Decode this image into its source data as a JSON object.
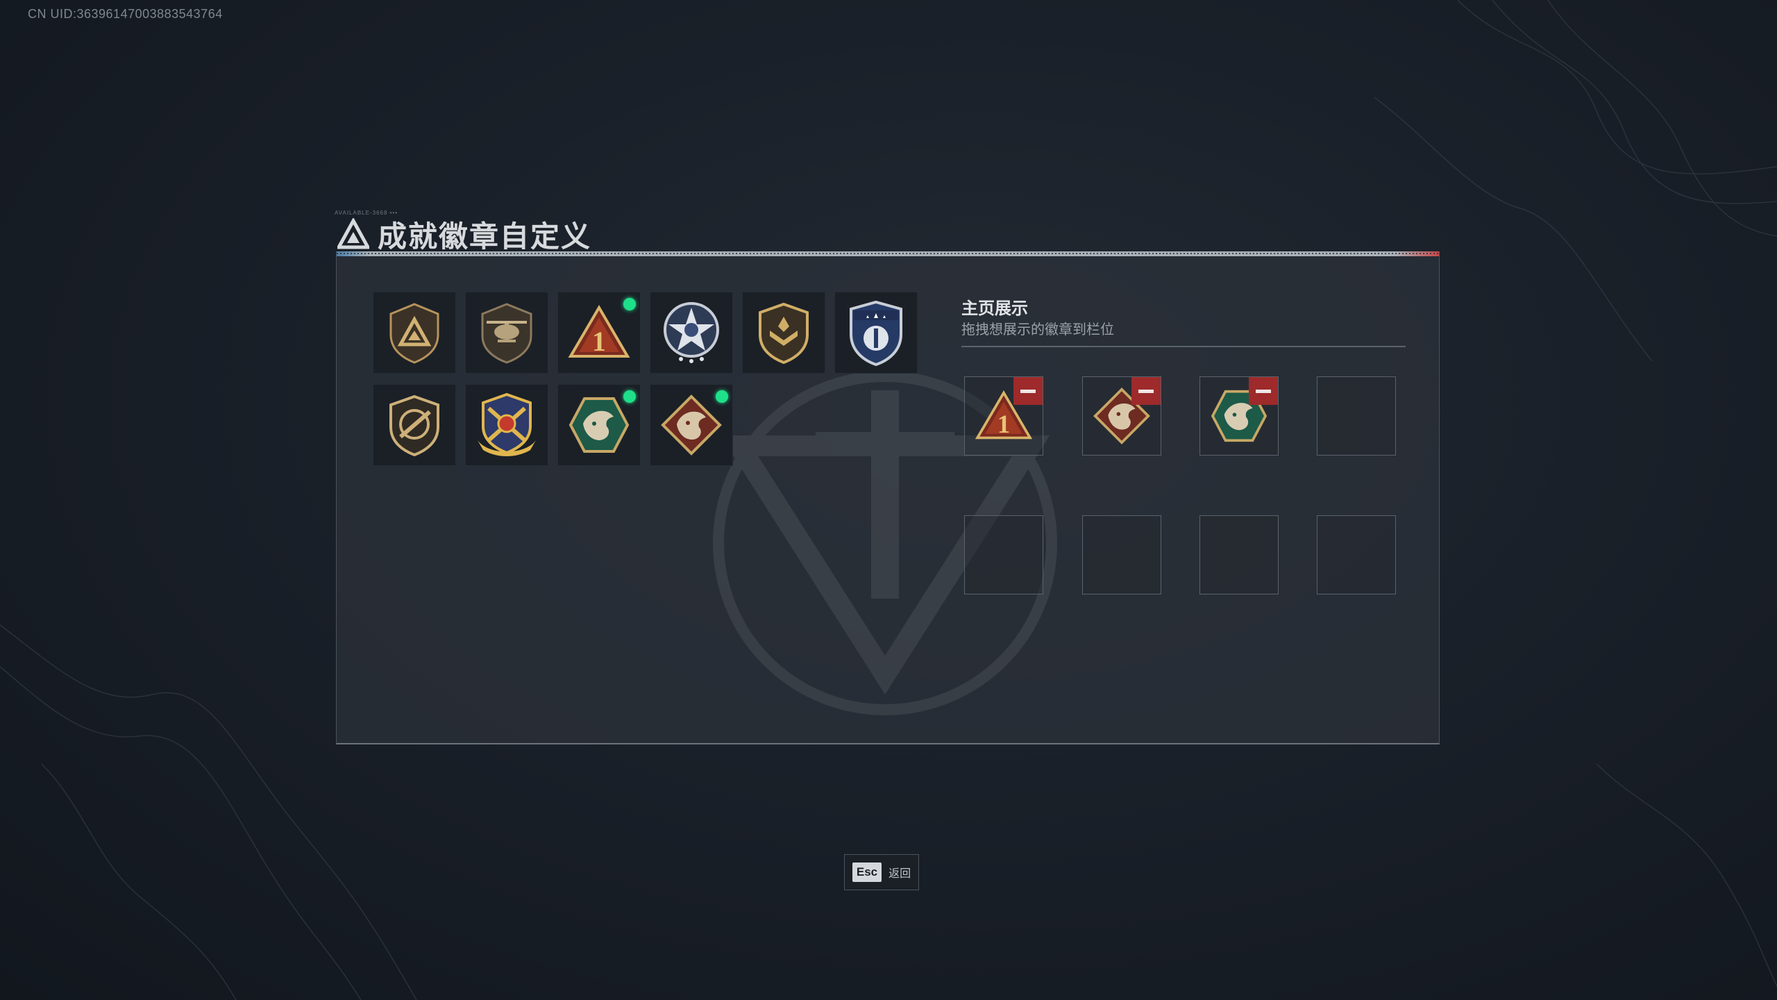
{
  "header": {
    "uid": "CN UID:3639614700388354376​4"
  },
  "page": {
    "title": "成就徽章自定义",
    "title_tiny": "AVAILABLE-3668 •••"
  },
  "badges": [
    {
      "name": "tri-shield-badge",
      "new": false
    },
    {
      "name": "helicopter-badge",
      "new": false
    },
    {
      "name": "number-one-triangle-badge",
      "new": true
    },
    {
      "name": "star-wreath-badge",
      "new": false
    },
    {
      "name": "gold-wing-shield-badge",
      "new": false
    },
    {
      "name": "blue-star-shield-badge",
      "new": false
    },
    {
      "name": "rifle-shield-badge",
      "new": false
    },
    {
      "name": "crossed-rifles-wing-badge",
      "new": false
    },
    {
      "name": "green-dragon-hex-badge",
      "new": true
    },
    {
      "name": "red-dragon-diamond-badge",
      "new": true
    }
  ],
  "showcase": {
    "title": "主页展示",
    "subtitle": "拖拽想展示的徽章到栏位",
    "slots": [
      {
        "badge": "number-one-triangle-badge"
      },
      {
        "badge": "red-dragon-diamond-badge"
      },
      {
        "badge": "green-dragon-hex-badge"
      },
      {
        "badge": ""
      },
      {
        "badge": ""
      },
      {
        "badge": ""
      },
      {
        "badge": ""
      },
      {
        "badge": ""
      }
    ]
  },
  "footer": {
    "esc_key": "Esc",
    "esc_label": "返回"
  },
  "colors": {
    "new_dot": "#1fe08a",
    "remove": "#9e2a2b",
    "gold": "#c9a45a"
  }
}
